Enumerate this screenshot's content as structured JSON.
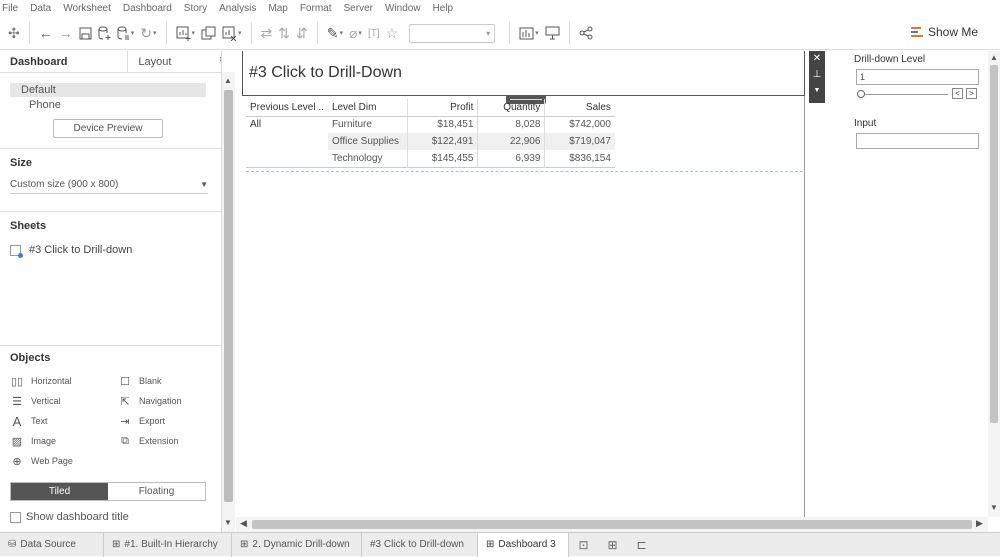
{
  "menu": [
    "File",
    "Data",
    "Worksheet",
    "Dashboard",
    "Story",
    "Analysis",
    "Map",
    "Format",
    "Server",
    "Window",
    "Help"
  ],
  "toolbar": {
    "show_me": "Show Me",
    "icons": [
      "tableau-logo-icon",
      "undo-icon",
      "redo-icon",
      "save-icon",
      "new-data-source-icon",
      "pause-auto-update-icon",
      "refresh-icon",
      "new-worksheet-icon",
      "duplicate-sheet-icon",
      "clear-sheet-icon",
      "swap-rows-columns-icon",
      "sort-ascending-icon",
      "sort-descending-icon",
      "highlight-icon",
      "group-members-icon",
      "show-mark-labels-icon",
      "fix-axes-icon",
      "fit-dropdown",
      "show-cards-icon",
      "presentation-mode-icon",
      "share-icon"
    ]
  },
  "left_panel": {
    "tabs": [
      "Dashboard",
      "Layout"
    ],
    "devices": [
      "Default",
      "Phone"
    ],
    "device_preview": "Device Preview",
    "size_heading": "Size",
    "size_value": "Custom size (900 x 800)",
    "sheets_heading": "Sheets",
    "sheets": [
      "#3 Click to Drill-down"
    ],
    "objects_heading": "Objects",
    "objects": [
      {
        "label": "Horizontal",
        "icon": "horizontal-container-icon"
      },
      {
        "label": "Blank",
        "icon": "blank-icon"
      },
      {
        "label": "Vertical",
        "icon": "vertical-container-icon"
      },
      {
        "label": "Navigation",
        "icon": "navigation-icon"
      },
      {
        "label": "Text",
        "icon": "text-icon"
      },
      {
        "label": "Export",
        "icon": "export-icon"
      },
      {
        "label": "Image",
        "icon": "image-icon"
      },
      {
        "label": "Extension",
        "icon": "extension-icon"
      },
      {
        "label": "Web Page",
        "icon": "web-page-icon"
      }
    ],
    "layout_modes": [
      "Tiled",
      "Floating"
    ],
    "show_title": "Show dashboard title"
  },
  "dashboard": {
    "title": "#3 Click to Drill-Down",
    "table": {
      "headers": [
        "Previous Level ..",
        "Level Dim",
        "Profit",
        "Quantity",
        "Sales"
      ],
      "rows": [
        {
          "prev": "All",
          "dim": "Furniture",
          "profit": "$18,451",
          "quantity": "8,028",
          "sales": "$742,000"
        },
        {
          "prev": "",
          "dim": "Office Supplies",
          "profit": "$122,491",
          "quantity": "22,906",
          "sales": "$719,047"
        },
        {
          "prev": "",
          "dim": "Technology",
          "profit": "$145,455",
          "quantity": "6,939",
          "sales": "$836,154"
        }
      ]
    }
  },
  "parameters": {
    "drill_label": "Drill-down Level",
    "drill_value": "1",
    "input_label": "Input",
    "input_value": ""
  },
  "bottom_tabs": [
    {
      "label": "Data Source",
      "icon": "database-icon"
    },
    {
      "label": "#1. Built-In Hierarchy",
      "icon": "grid-icon"
    },
    {
      "label": "2. Dynamic Drill-down",
      "icon": "grid-icon"
    },
    {
      "label": "#3 Click to Drill-down",
      "icon": ""
    },
    {
      "label": "Dashboard 3",
      "icon": "grid-icon",
      "active": true
    }
  ]
}
